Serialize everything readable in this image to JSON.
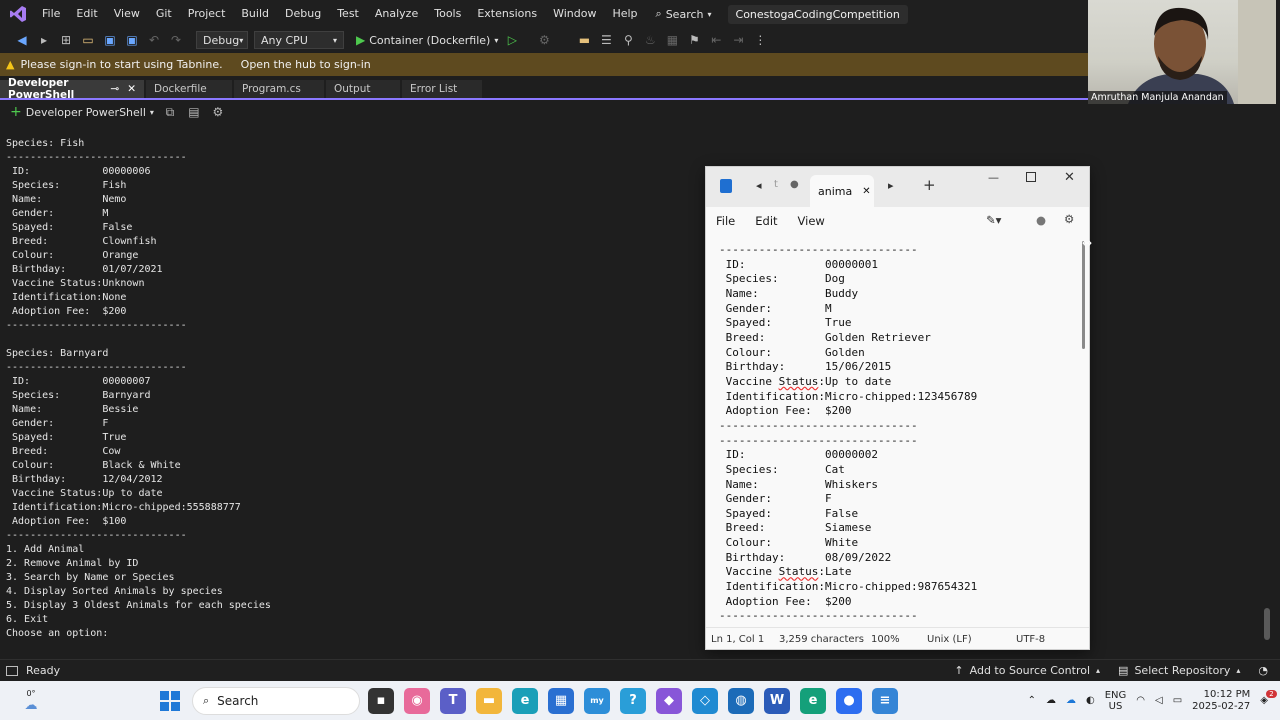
{
  "menu": {
    "items": [
      "File",
      "Edit",
      "View",
      "Git",
      "Project",
      "Build",
      "Debug",
      "Test",
      "Analyze",
      "Tools",
      "Extensions",
      "Window",
      "Help"
    ],
    "search_label": "Search",
    "solution_name": "ConestogaCodingCompetition"
  },
  "toolbar": {
    "config": "Debug",
    "platform": "Any CPU",
    "run_target": "Container (Dockerfile)"
  },
  "infobar": {
    "message": "Please sign-in to start using Tabnine.",
    "link": "Open the hub to sign-in"
  },
  "tabs": [
    {
      "label": "Developer PowerShell",
      "active": true
    },
    {
      "label": "Dockerfile"
    },
    {
      "label": "Program.cs"
    },
    {
      "label": "Output"
    },
    {
      "label": "Error List"
    }
  ],
  "terminal_header": {
    "shell_label": "Developer PowerShell"
  },
  "terminal_lines": [
    "Species: Fish",
    "------------------------------",
    " ID:            00000006",
    " Species:       Fish",
    " Name:          Nemo",
    " Gender:        M",
    " Spayed:        False",
    " Breed:         Clownfish",
    " Colour:        Orange",
    " Birthday:      01/07/2021",
    " Vaccine Status:Unknown",
    " Identification:None",
    " Adoption Fee:  $200",
    "------------------------------",
    "",
    "Species: Barnyard",
    "------------------------------",
    " ID:            00000007",
    " Species:       Barnyard",
    " Name:          Bessie",
    " Gender:        F",
    " Spayed:        True",
    " Breed:         Cow",
    " Colour:        Black & White",
    " Birthday:      12/04/2012",
    " Vaccine Status:Up to date",
    " Identification:Micro-chipped:555888777",
    " Adoption Fee:  $100",
    "------------------------------",
    "1. Add Animal",
    "2. Remove Animal by ID",
    "3. Search by Name or Species",
    "4. Display Sorted Animals by species",
    "5. Display 3 Oldest Animals for each species",
    "6. Exit",
    "Choose an option:"
  ],
  "webcam": {
    "name": "Amruthan Manjula Anandan"
  },
  "notepad": {
    "tab_title": "anima",
    "tab_prev": "t",
    "menu": [
      "File",
      "Edit",
      "View"
    ],
    "lines": [
      "------------------------------",
      " ID:            00000001",
      " Species:       Dog",
      " Name:          Buddy",
      " Gender:        M",
      " Spayed:        True",
      " Breed:         Golden Retriever",
      " Colour:        Golden",
      " Birthday:      15/06/2015",
      " Vaccine Status:Up to date",
      " Identification:Micro-chipped:123456789",
      " Adoption Fee:  $200",
      "------------------------------",
      "------------------------------",
      " ID:            00000002",
      " Species:       Cat",
      " Name:          Whiskers",
      " Gender:        F",
      " Spayed:        False",
      " Breed:         Siamese",
      " Colour:        White",
      " Birthday:      08/09/2022",
      " Vaccine Status:Late",
      " Identification:Micro-chipped:987654321",
      " Adoption Fee:  $200",
      "------------------------------"
    ],
    "status": {
      "position": "Ln 1, Col 1",
      "chars": "3,259 characters",
      "zoom": "100%",
      "eol": "Unix (LF)",
      "encoding": "UTF-8"
    }
  },
  "statusbar": {
    "ready": "Ready",
    "add_source": "Add to Source Control",
    "select_repo": "Select Repository"
  },
  "taskbar": {
    "weather": "0°",
    "search": "Search",
    "lang": "ENG",
    "region": "US",
    "time": "10:12 PM",
    "date": "2025-02-27",
    "notif_count": "2"
  }
}
